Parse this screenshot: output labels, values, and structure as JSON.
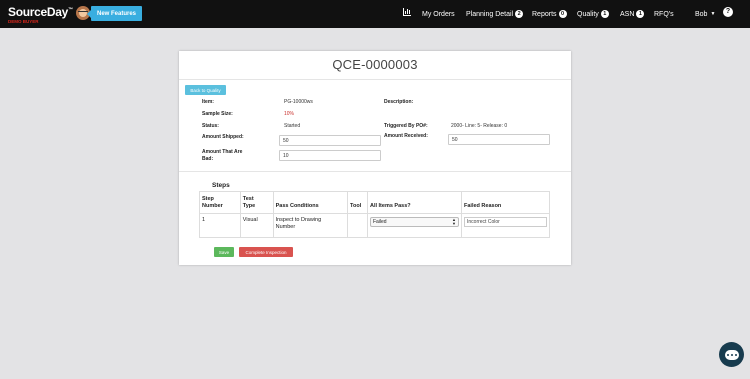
{
  "brand": {
    "name": "SourceDay",
    "subtitle": "DEMO BUYER"
  },
  "nav": {
    "new_features": "New Features",
    "my_orders": "My Orders",
    "planning_detail": "Planning Detail",
    "planning_detail_badge": "2",
    "reports": "Reports",
    "reports_badge": "0",
    "quality": "Quality",
    "quality_badge": "1",
    "asn": "ASN",
    "asn_badge": "1",
    "rfqs": "RFQ's",
    "user": "Bob",
    "help": "?"
  },
  "page": {
    "title": "QCE-0000003",
    "back_label": "Back to Quality"
  },
  "fields": {
    "item_label": "Item:",
    "item_value": "PG-10000ws",
    "description_label": "Description:",
    "sample_size_label": "Sample Size:",
    "sample_size_value": "10%",
    "status_label": "Status:",
    "status_value": "Started",
    "triggered_label": "Triggered By PO#:",
    "triggered_value": "2000- Line: 5- Release: 0",
    "amount_shipped_label": "Amount Shipped:",
    "amount_shipped_value": "50",
    "amount_received_label": "Amount Received:",
    "amount_received_value": "50",
    "amount_bad_label_1": "Amount That Are",
    "amount_bad_label_2": "Bad:",
    "amount_bad_value": "10"
  },
  "steps": {
    "heading": "Steps",
    "columns": {
      "step_number_1": "Step",
      "step_number_2": "Number",
      "test_type_1": "Test",
      "test_type_2": "Type",
      "pass_conditions": "Pass Conditions",
      "tool": "Tool",
      "all_items_pass": "All Items Pass?",
      "failed_reason": "Failed Reason"
    },
    "rows": [
      {
        "number": "1",
        "type": "Visual",
        "pass_conditions_1": "Inspect to Drawing",
        "pass_conditions_2": "Number",
        "tool": "",
        "all_items_pass": "Failed",
        "failed_reason": "Incorrect Color"
      }
    ]
  },
  "actions": {
    "save": "Save",
    "complete": "Complete Inspection"
  }
}
